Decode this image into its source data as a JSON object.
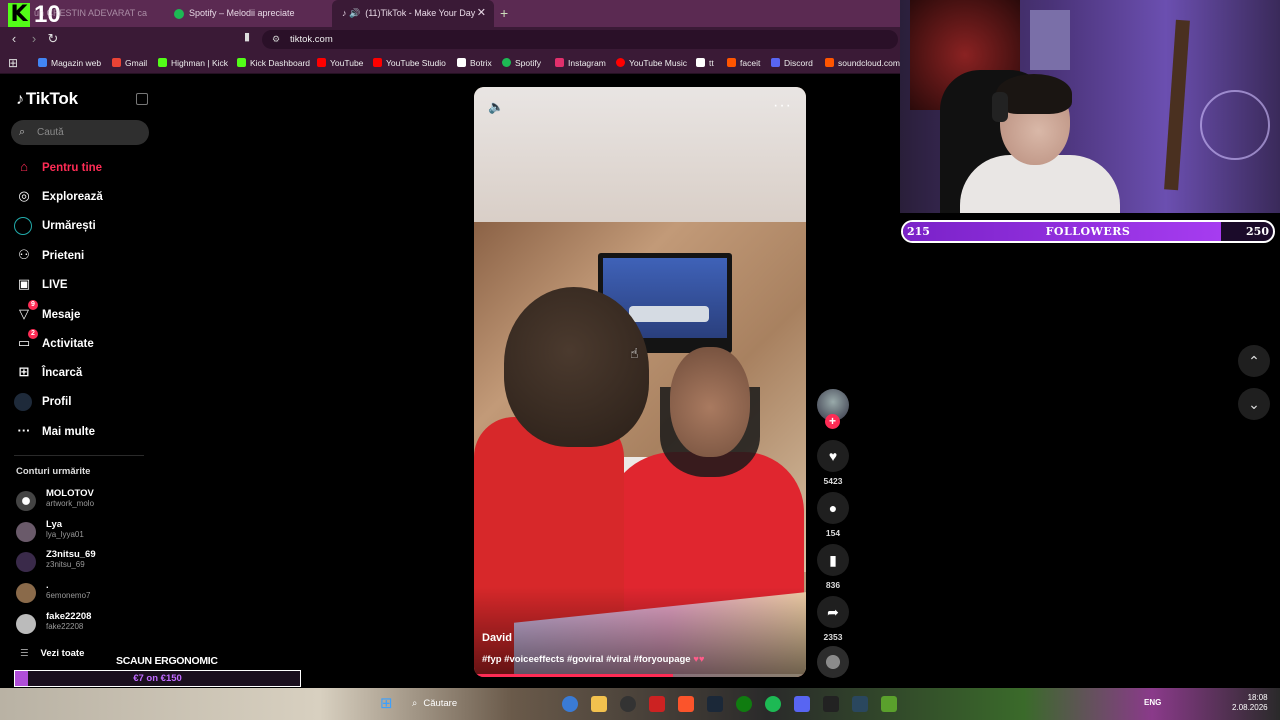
{
  "browser": {
    "stream_overlay_logo": {
      "letter": "K",
      "number": "10"
    },
    "tabs": [
      {
        "label": "un CRESTIN ADEVARAT ca",
        "active": false
      },
      {
        "label": "Spotify – Melodii apreciate",
        "active": false
      },
      {
        "label": "(11)TikTok - Make Your Day",
        "active": true
      }
    ],
    "new_tab": "+",
    "close_tab": "✕",
    "url": "tiktok.com",
    "bookmarks": [
      {
        "label": "Magazin web",
        "color": "#4285f4"
      },
      {
        "label": "Gmail",
        "color": "#ea4335"
      },
      {
        "label": "Highman | Kick",
        "color": "#53fc18"
      },
      {
        "label": "Kick Dashboard",
        "color": "#53fc18"
      },
      {
        "label": "YouTube",
        "color": "#ff0000"
      },
      {
        "label": "YouTube Studio",
        "color": "#ff0000"
      },
      {
        "label": "Botrix",
        "color": "#ffffff"
      },
      {
        "label": "Spotify",
        "color": "#1db954"
      },
      {
        "label": "Instagram",
        "color": "#e1306c"
      },
      {
        "label": "YouTube Music",
        "color": "#ff0000"
      },
      {
        "label": "tt",
        "color": "#ffffff"
      },
      {
        "label": "faceit",
        "color": "#ff5500"
      },
      {
        "label": "Discord",
        "color": "#5865f2"
      },
      {
        "label": "soundcloud.com/",
        "color": "#ff5500"
      }
    ]
  },
  "sidebar": {
    "logo": "TikTok",
    "search_placeholder": "Caută",
    "nav": [
      {
        "label": "Pentru tine",
        "icon": "home-icon",
        "active": true
      },
      {
        "label": "Explorează",
        "icon": "compass-icon"
      },
      {
        "label": "Urmărești",
        "icon": "following-icon"
      },
      {
        "label": "Prieteni",
        "icon": "friends-icon"
      },
      {
        "label": "LIVE",
        "icon": "live-icon"
      },
      {
        "label": "Mesaje",
        "icon": "messages-icon",
        "badge": "9"
      },
      {
        "label": "Activitate",
        "icon": "activity-icon",
        "badge": "2"
      },
      {
        "label": "Încarcă",
        "icon": "upload-icon"
      },
      {
        "label": "Profil",
        "icon": "profile-icon"
      },
      {
        "label": "Mai multe",
        "icon": "more-icon"
      }
    ],
    "following_title": "Conturi urmărite",
    "accounts": [
      {
        "name": "MOLOTOV",
        "handle": "artwork_molo"
      },
      {
        "name": "Lya",
        "handle": "lya_lyya01"
      },
      {
        "name": "Z3nitsu_69",
        "handle": "z3nitsu_69"
      },
      {
        "name": ".",
        "handle": "6emonemo7"
      },
      {
        "name": "fake22208",
        "handle": "fake22208"
      }
    ],
    "see_all": "Vezi toate"
  },
  "video": {
    "author": "David",
    "caption": "#fyp #voiceeffects #goviral #viral #foryoupage",
    "caption_emoji": "♥♥",
    "progress": 0.6
  },
  "actions": {
    "likes": "5423",
    "comments": "154",
    "saves": "836",
    "shares": "2353"
  },
  "stream_overlay": {
    "followers_current": "215",
    "followers_label": "FOLLOWERS",
    "followers_goal": "250",
    "followers_progress": 0.86,
    "goal_title": "SCAUN ERGONOMIC",
    "goal_amount": "€7 on €150",
    "goal_progress": 0.047
  },
  "taskbar": {
    "search": "Căutare",
    "lang": "ENG",
    "time": "18:08",
    "date": "2.08.2026"
  }
}
